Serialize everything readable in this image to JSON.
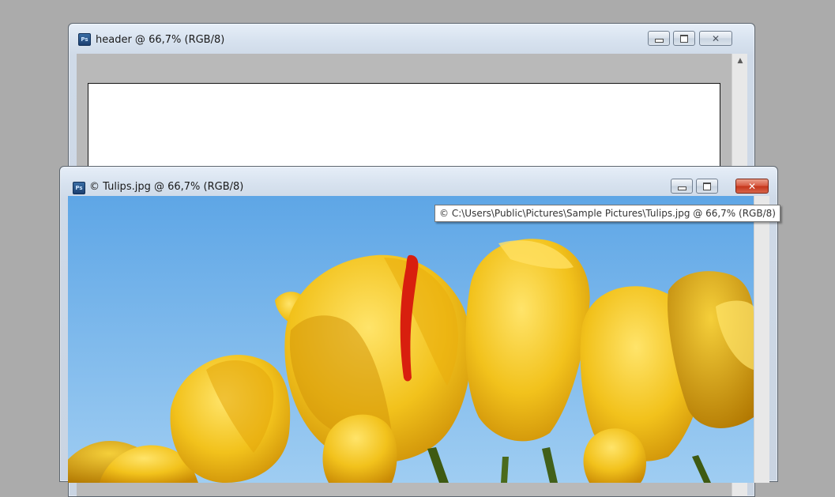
{
  "back_window": {
    "title": "header @ 66,7% (RGB/8)",
    "icon": "photoshop-document-icon",
    "icon_text": "Ps",
    "buttons": {
      "minimize": "minimize-icon",
      "maximize": "maximize-icon",
      "close": "close-icon"
    },
    "close_glyph": "✕",
    "scroll_up_glyph": "▲"
  },
  "front_window": {
    "title": "© Tulips.jpg @ 66,7% (RGB/8)",
    "icon": "photoshop-document-icon",
    "icon_text": "Ps",
    "buttons": {
      "minimize": "minimize-icon",
      "maximize": "maximize-icon",
      "close": "close-icon"
    },
    "close_glyph": "✕",
    "close_color": "#c43419",
    "image": "yellow tulips against blue sky"
  },
  "tooltip": {
    "text": "© C:\\Users\\Public\\Pictures\\Sample Pictures\\Tulips.jpg @ 66,7% (RGB/8)"
  },
  "colors": {
    "workspace": "#ababab",
    "sky": "#6fb0e8",
    "tulip_yellow": "#f0bf18"
  }
}
